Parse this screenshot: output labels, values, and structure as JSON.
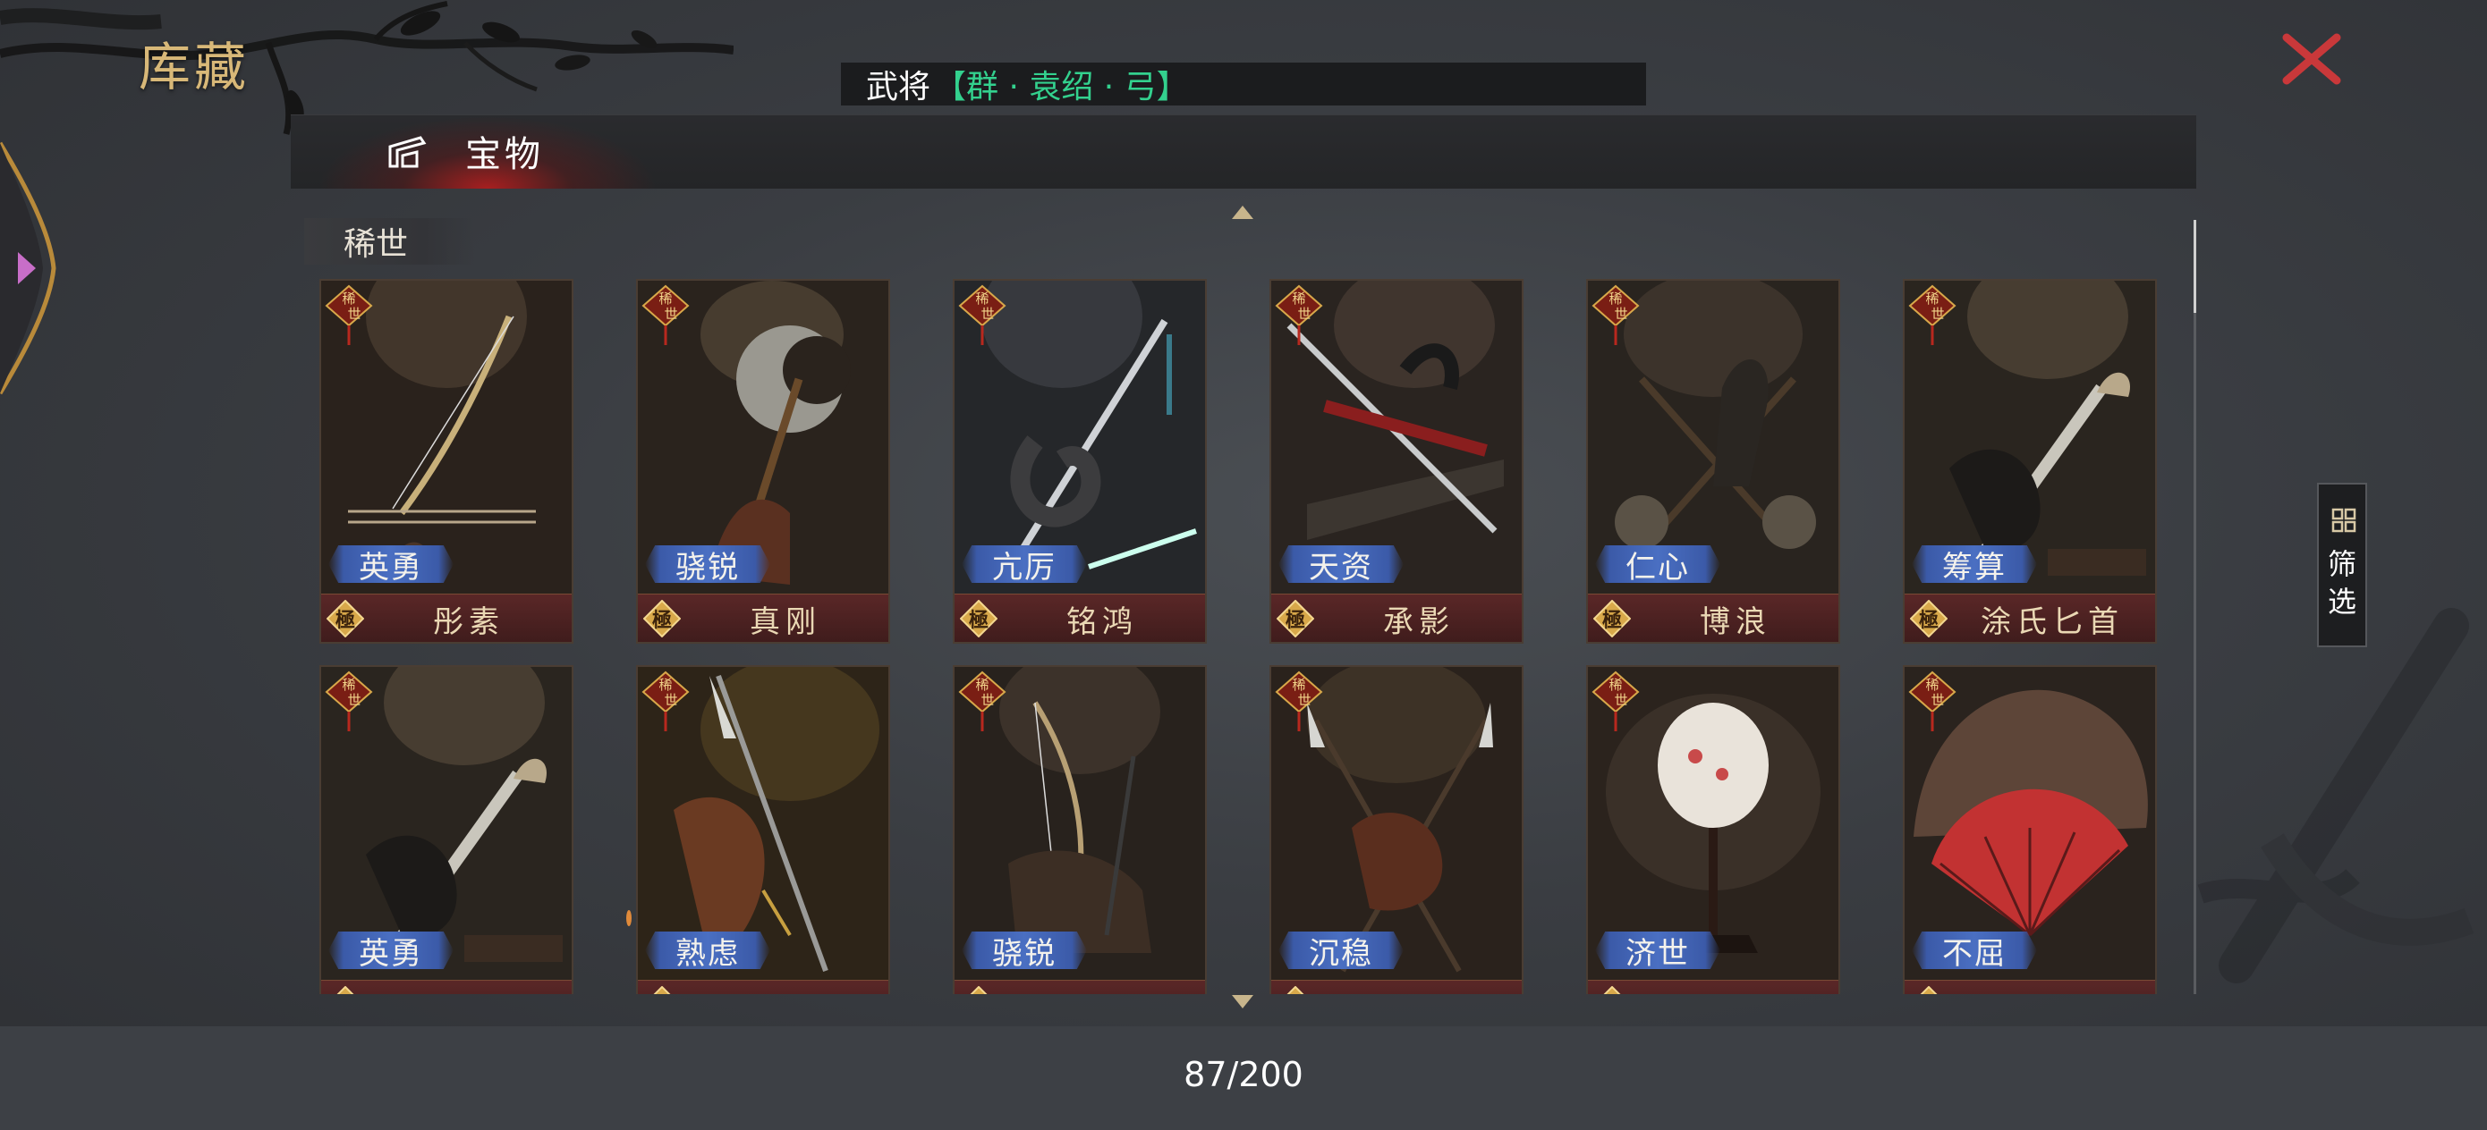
{
  "header": {
    "title": "库藏"
  },
  "general": {
    "label": "武将",
    "value": "【群 · 袁绍 · 弓】"
  },
  "tabs": [
    {
      "label": "宝物",
      "active": true,
      "icon": "treasure-icon"
    }
  ],
  "section": {
    "label": "稀世"
  },
  "colors": {
    "accent_gold": "#d8b878",
    "close_red": "#c9383a",
    "trait_blue": "#4a6fc2",
    "general_green": "#33d18e"
  },
  "cards": [
    {
      "rarity": "稀世",
      "trait": "英勇",
      "grade": "極",
      "name": "彤素",
      "art": "bow"
    },
    {
      "rarity": "稀世",
      "trait": "骁锐",
      "grade": "極",
      "name": "真刚",
      "art": "axe"
    },
    {
      "rarity": "稀世",
      "trait": "亢厉",
      "grade": "極",
      "name": "铭鸿",
      "art": "sword-dragon"
    },
    {
      "rarity": "稀世",
      "trait": "天资",
      "grade": "極",
      "name": "承影",
      "art": "sword-stand"
    },
    {
      "rarity": "稀世",
      "trait": "仁心",
      "grade": "極",
      "name": "博浪",
      "art": "hammers"
    },
    {
      "rarity": "稀世",
      "trait": "筹算",
      "grade": "極",
      "name": "涂氏匕首",
      "art": "dagger"
    },
    {
      "rarity": "稀世",
      "trait": "英勇",
      "grade": "極",
      "name": "",
      "art": "dagger"
    },
    {
      "rarity": "稀世",
      "trait": "熟虑",
      "grade": "極",
      "name": "",
      "art": "halberd"
    },
    {
      "rarity": "稀世",
      "trait": "骁锐",
      "grade": "極",
      "name": "",
      "art": "bow-stand"
    },
    {
      "rarity": "稀世",
      "trait": "沉稳",
      "grade": "極",
      "name": "",
      "art": "spears"
    },
    {
      "rarity": "稀世",
      "trait": "济世",
      "grade": "極",
      "name": "",
      "art": "round-fan"
    },
    {
      "rarity": "稀世",
      "trait": "不屈",
      "grade": "極",
      "name": "",
      "art": "feather-fan"
    }
  ],
  "filter": {
    "label": "筛选",
    "icon": "grid-filter-icon"
  },
  "inventory": {
    "count": "87/200"
  }
}
